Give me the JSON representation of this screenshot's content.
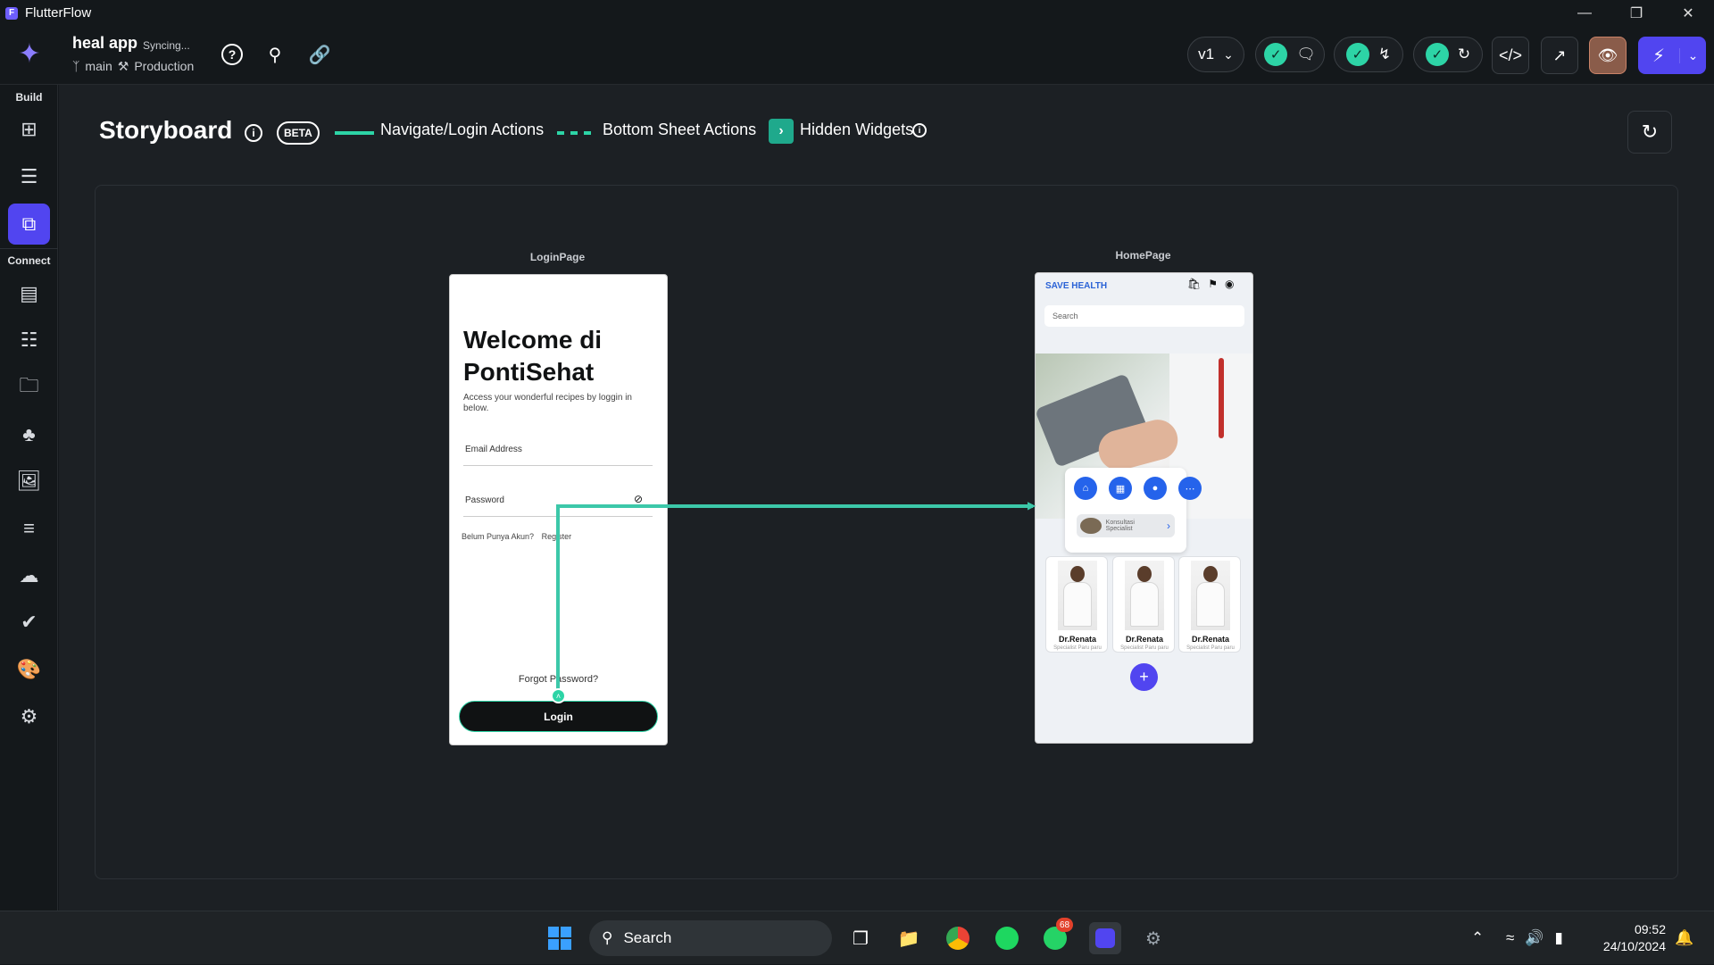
{
  "window": {
    "app_name": "FlutterFlow"
  },
  "header": {
    "project_name": "heal app",
    "sync_status": "Syncing...",
    "branch": "main",
    "environment": "Production",
    "version_label": "v1"
  },
  "sidebar": {
    "build_label": "Build",
    "connect_label": "Connect"
  },
  "storyboard": {
    "title": "Storyboard",
    "beta_label": "BETA",
    "legend": {
      "navigate": "Navigate/Login Actions",
      "bottom_sheet": "Bottom Sheet Actions",
      "hidden": "Hidden Widgets"
    }
  },
  "login_page": {
    "label": "LoginPage",
    "title": "Welcome di PontiSehat",
    "subtitle": "Access your wonderful recipes by loggin in below.",
    "email_label": "Email Address",
    "password_label": "Password",
    "no_account": "Belum Punya Akun?",
    "register": "Register",
    "forgot": "Forgot Password?",
    "login_button": "Login"
  },
  "home_page": {
    "label": "HomePage",
    "brand": "SAVE HEALTH",
    "search_placeholder": "Search",
    "consult": "Konsultasi Specialist",
    "doctors": [
      {
        "name": "Dr.Renata",
        "spec": "Specialist Paru paru"
      },
      {
        "name": "Dr.Renata",
        "spec": "Specialist Paru paru"
      },
      {
        "name": "Dr.Renata",
        "spec": "Specialist Paru paru"
      }
    ]
  },
  "taskbar": {
    "search_label": "Search",
    "whatsapp_badge": "68",
    "time": "09:52",
    "date": "24/10/2024"
  },
  "colors": {
    "accent": "#5145f0",
    "teal": "#2dd4a6",
    "brand_blue": "#2a62d6"
  }
}
